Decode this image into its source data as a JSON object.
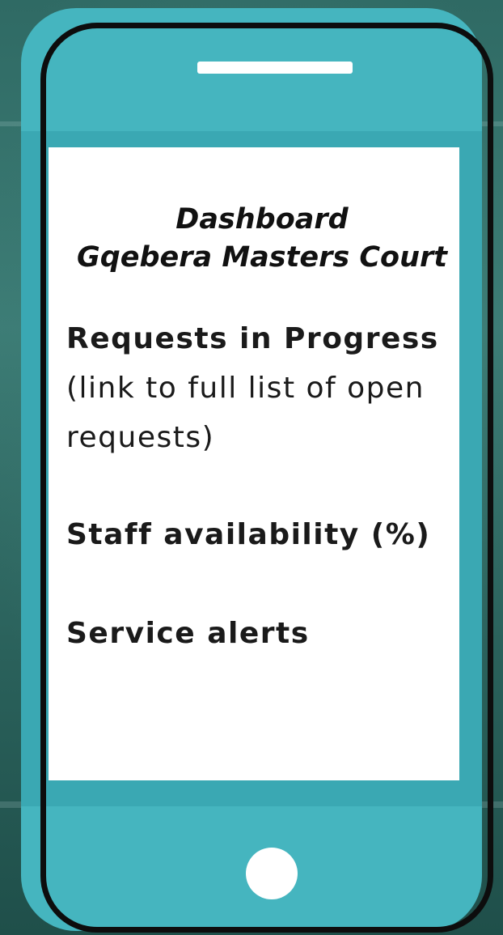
{
  "dashboard": {
    "title": "Dashboard",
    "court_name": "Gqebera Masters Court",
    "requests_bold": "Requests in Progress",
    "requests_link": "(link to full list of open requests)",
    "staff_availability": "Staff availability (%)",
    "service_alerts": "Service alerts"
  }
}
